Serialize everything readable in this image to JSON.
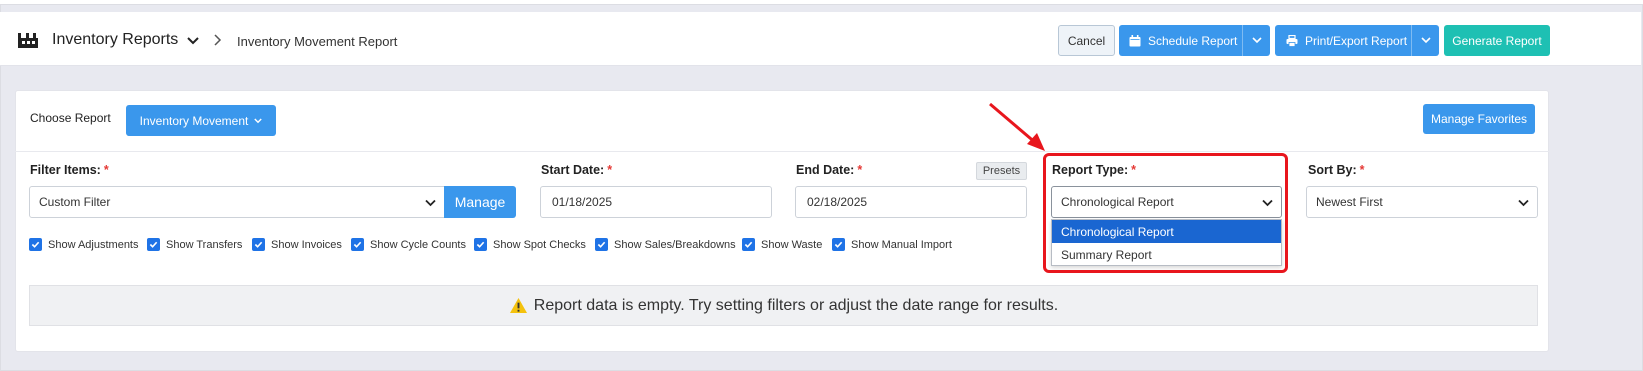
{
  "header": {
    "title": "Inventory Reports",
    "breadcrumb": "Inventory Movement Report",
    "buttons": {
      "cancel": "Cancel",
      "schedule": "Schedule Report",
      "print_export": "Print/Export Report",
      "generate": "Generate Report"
    }
  },
  "toolbar": {
    "choose_report_label": "Choose Report",
    "choose_report_value": "Inventory Movement",
    "manage_favorites": "Manage Favorites"
  },
  "filters": {
    "filter_items": {
      "label": "Filter Items:",
      "value": "Custom Filter",
      "manage": "Manage"
    },
    "start_date": {
      "label": "Start Date:",
      "value": "01/18/2025"
    },
    "end_date": {
      "label": "End Date:",
      "value": "02/18/2025",
      "presets": "Presets"
    },
    "report_type": {
      "label": "Report Type:",
      "value": "Chronological Report",
      "options": [
        "Chronological Report",
        "Summary Report"
      ],
      "selected_index": 0
    },
    "sort_by": {
      "label": "Sort By:",
      "value": "Newest First"
    },
    "required_mark": "*"
  },
  "checkboxes": [
    {
      "label": "Show Adjustments",
      "checked": true
    },
    {
      "label": "Show Transfers",
      "checked": true
    },
    {
      "label": "Show Invoices",
      "checked": true
    },
    {
      "label": "Show Cycle Counts",
      "checked": true
    },
    {
      "label": "Show Spot Checks",
      "checked": true
    },
    {
      "label": "Show Sales/Breakdowns",
      "checked": true
    },
    {
      "label": "Show Waste",
      "checked": true
    },
    {
      "label": "Show Manual Import",
      "checked": true
    }
  ],
  "empty_message": "Report data is empty. Try setting filters or adjust the date range for results.",
  "colors": {
    "primary": "#3a97ec",
    "teal": "#1ec0b3",
    "highlight": "#e8161d",
    "checkbox": "#1f73e6",
    "warning": "#f4c20d"
  }
}
